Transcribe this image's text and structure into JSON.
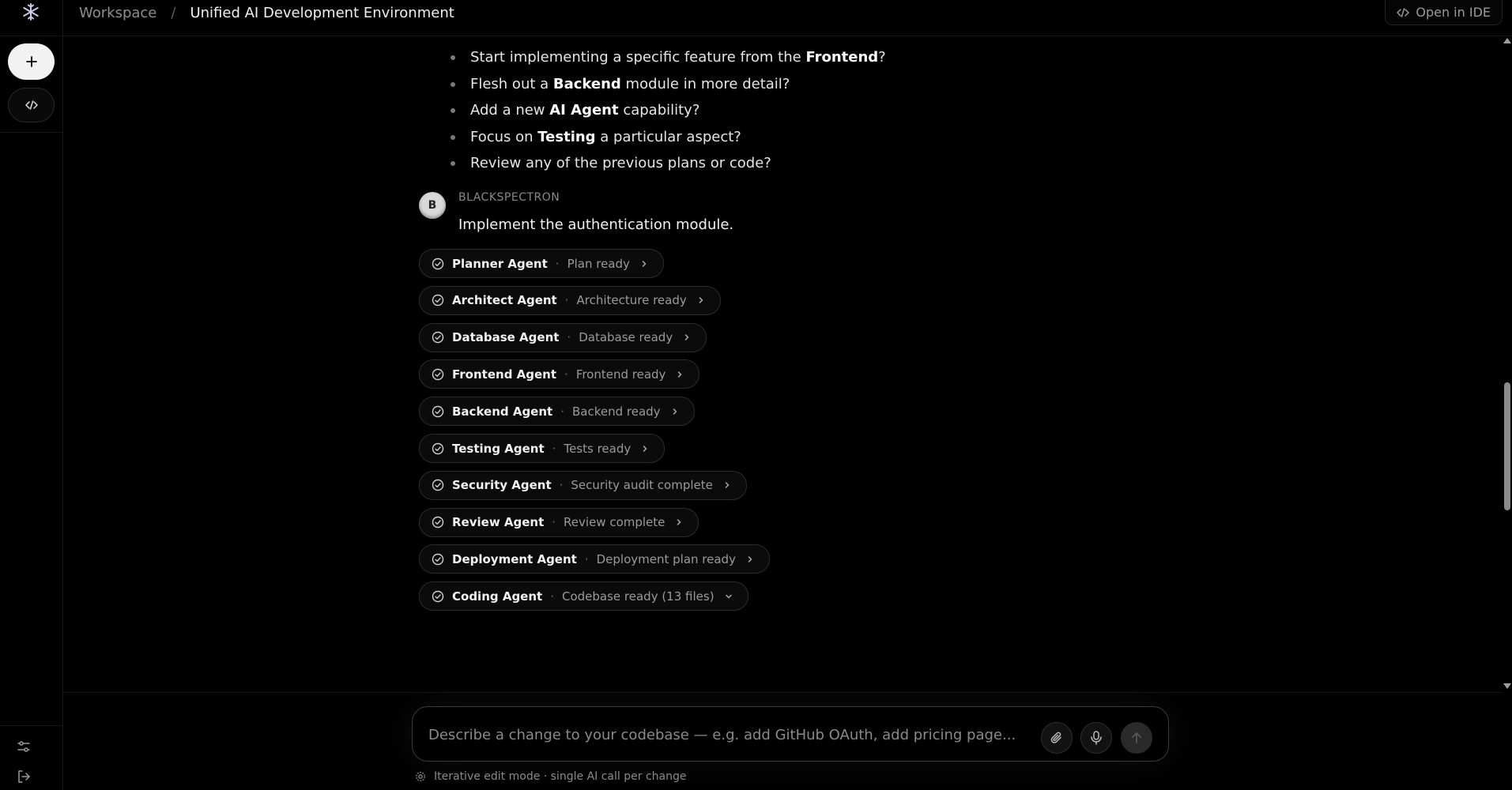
{
  "header": {
    "breadcrumb_root": "Workspace",
    "breadcrumb_separator": "/",
    "title": "Unified AI Development Environment",
    "open_ide_label": "Open in IDE"
  },
  "sidebar": {
    "new_button_label": "+",
    "code_button_icon": "code-icon",
    "bottom_icons": [
      "sliders-icon",
      "logout-icon"
    ]
  },
  "conversation": {
    "bullets": [
      {
        "pre": "Start implementing a specific feature from the ",
        "bold": "Frontend",
        "post": "?"
      },
      {
        "pre": "Flesh out a ",
        "bold": "Backend",
        "post": " module in more detail?"
      },
      {
        "pre": "Add a new ",
        "bold": "AI Agent",
        "post": " capability?"
      },
      {
        "pre": "Focus on ",
        "bold": "Testing",
        "post": " a particular aspect?"
      },
      {
        "pre": "Review any of the previous plans or code?",
        "bold": "",
        "post": ""
      }
    ],
    "user_message": {
      "avatar_letter": "B",
      "author": "BLACKSPECTRON",
      "text": "Implement the authentication module."
    },
    "agents": [
      {
        "name": "Planner Agent",
        "status": "Plan ready",
        "expanded": false
      },
      {
        "name": "Architect Agent",
        "status": "Architecture ready",
        "expanded": false
      },
      {
        "name": "Database Agent",
        "status": "Database ready",
        "expanded": false
      },
      {
        "name": "Frontend Agent",
        "status": "Frontend ready",
        "expanded": false
      },
      {
        "name": "Backend Agent",
        "status": "Backend ready",
        "expanded": false
      },
      {
        "name": "Testing Agent",
        "status": "Tests ready",
        "expanded": false
      },
      {
        "name": "Security Agent",
        "status": "Security audit complete",
        "expanded": false
      },
      {
        "name": "Review Agent",
        "status": "Review complete",
        "expanded": false
      },
      {
        "name": "Deployment Agent",
        "status": "Deployment plan ready",
        "expanded": false
      },
      {
        "name": "Coding Agent",
        "status": "Codebase ready (13 files)",
        "expanded": true
      }
    ],
    "agent_separator": "·"
  },
  "composer": {
    "placeholder": "Describe a change to your codebase — e.g. add GitHub OAuth, add pricing page...",
    "value": "",
    "hint": "Iterative edit mode · single AI call per change"
  },
  "colors": {
    "background": "#000000",
    "text": "#e8e8e8",
    "muted": "#8a8a8a",
    "border": "#2c2c2c"
  }
}
